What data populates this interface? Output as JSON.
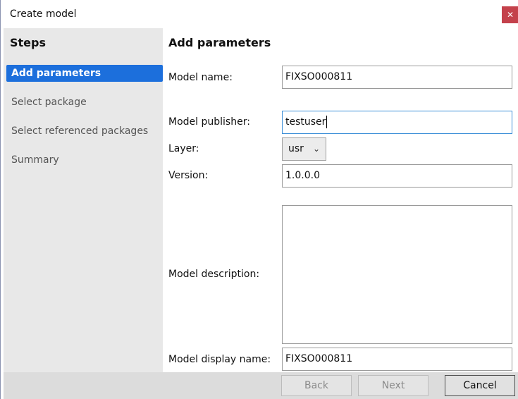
{
  "window": {
    "title": "Create model",
    "close_glyph": "✕"
  },
  "sidebar": {
    "heading": "Steps",
    "items": [
      {
        "label": "Add parameters",
        "active": true
      },
      {
        "label": "Select package",
        "active": false
      },
      {
        "label": "Select referenced packages",
        "active": false
      },
      {
        "label": "Summary",
        "active": false
      }
    ]
  },
  "main": {
    "heading": "Add parameters",
    "fields": {
      "model_name": {
        "label": "Model name:",
        "value": "FIXSO000811"
      },
      "model_publisher": {
        "label": "Model publisher:",
        "value": "testuser"
      },
      "layer": {
        "label": "Layer:",
        "value": "usr"
      },
      "version": {
        "label": "Version:",
        "value": "1.0.0.0"
      },
      "model_description": {
        "label": "Model description:",
        "value": ""
      },
      "model_display_name": {
        "label": "Model display name:",
        "value": "FIXSO000811"
      }
    }
  },
  "footer": {
    "back_label": "Back",
    "next_label": "Next",
    "cancel_label": "Cancel"
  },
  "colors": {
    "accent": "#1c6fdc",
    "close": "#c4414b",
    "sidebar_bg": "#e8e8e8"
  }
}
